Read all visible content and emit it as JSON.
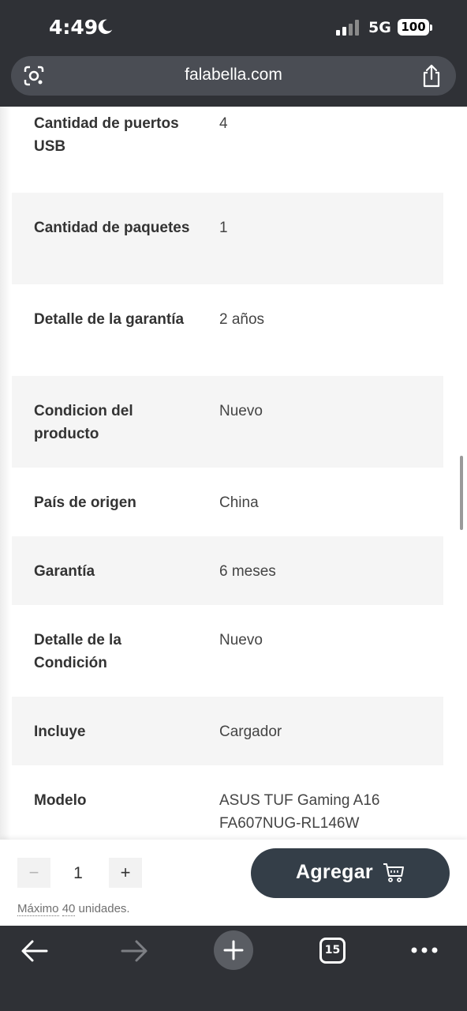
{
  "status_bar": {
    "time": "4:49",
    "network": "5G",
    "battery": "100"
  },
  "browser": {
    "url": "falabella.com"
  },
  "specs": [
    {
      "label": "Cantidad de puertos USB",
      "value": "4",
      "shaded": false
    },
    {
      "label": "Cantidad de paquetes",
      "value": "1",
      "shaded": true
    },
    {
      "label": "Detalle de la garantía",
      "value": "2 años",
      "shaded": false
    },
    {
      "label": "Condicion del producto",
      "value": "Nuevo",
      "shaded": true
    },
    {
      "label": "País de origen",
      "value": "China",
      "shaded": false
    },
    {
      "label": "Garantía",
      "value": "6 meses",
      "shaded": true
    },
    {
      "label": "Detalle de la Condición",
      "value": "Nuevo",
      "shaded": false
    },
    {
      "label": "Incluye",
      "value": "Cargador",
      "shaded": true
    },
    {
      "label": "Modelo",
      "value": "ASUS TUF Gaming A16 FA607NUG-RL146W",
      "shaded": false
    }
  ],
  "purchase": {
    "minus_label": "−",
    "quantity": "1",
    "plus_label": "+",
    "max_prefix": "Máximo",
    "max_number": "40",
    "max_suffix": "unidades.",
    "add_label": "Agregar"
  },
  "toolbar": {
    "tab_count": "15"
  },
  "colors": {
    "chrome": "#2f3136",
    "add_button": "#343e48",
    "row_shade": "#f5f5f5"
  }
}
